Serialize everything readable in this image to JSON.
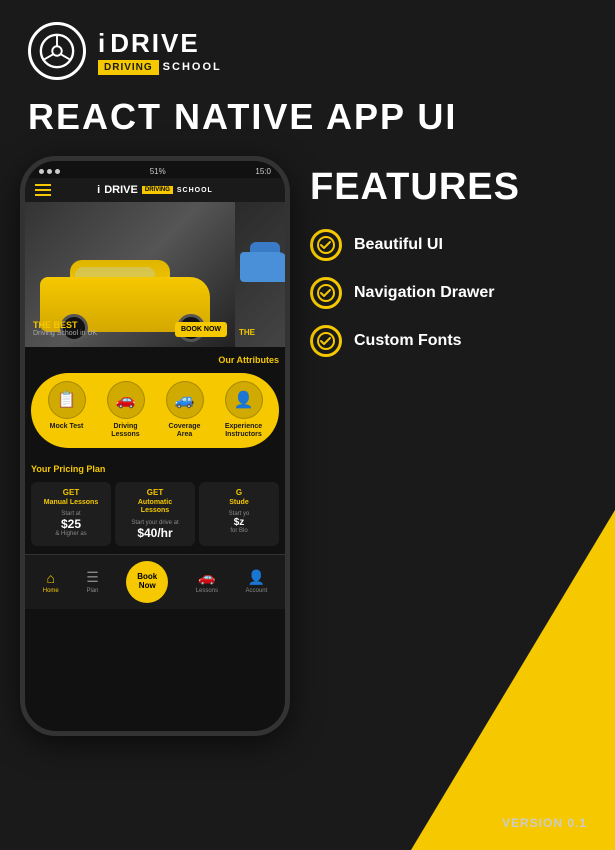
{
  "header": {
    "logo_i": "i",
    "logo_drive": "DRIVE",
    "badge_driving": "DRIVING",
    "badge_school": "SCHOOL"
  },
  "main_title": "REACT NATIVE APP UI",
  "phone": {
    "status_bar": {
      "left": "≡",
      "battery": "51%",
      "time": "15:0"
    },
    "app_header": {
      "logo_i": "i",
      "logo_drive": "DRIVE",
      "badge": "DRIVING",
      "school": "SCHOOL"
    },
    "carousel": {
      "main_label": "THE BEST",
      "main_sublabel": "Driving School in UK",
      "btn_label": "BOOK NOW",
      "side_label": "THE"
    },
    "attributes": {
      "title": "Our Attributes",
      "items": [
        {
          "label": "Mock Test",
          "icon": "📋"
        },
        {
          "label": "Driving\nLessons",
          "icon": "🚗"
        },
        {
          "label": "Coverage\nArea",
          "icon": "🚙"
        },
        {
          "label": "Experience\nInstructors",
          "icon": "👤"
        }
      ]
    },
    "pricing": {
      "title": "Your Pricing Plan",
      "cards": [
        {
          "get": "GET",
          "type": "Manual Lessons",
          "start_text": "Start at",
          "price": "$25",
          "note": "& Higher as"
        },
        {
          "get": "GET",
          "type": "Automatic\nLessons",
          "start_text": "Start your drive at",
          "price": "$40/hr",
          "note": ""
        },
        {
          "get": "G",
          "type": "Stude",
          "start_text": "Start yo",
          "price": "$z",
          "note": "for Blo"
        }
      ]
    },
    "bottom_nav": {
      "items": [
        {
          "label": "Home",
          "active": true
        },
        {
          "label": "Plan",
          "active": false
        },
        {
          "label": "Book\nNow",
          "is_cta": true
        },
        {
          "label": "Lessons",
          "active": false
        },
        {
          "label": "Account",
          "active": false
        }
      ],
      "book_btn": "Book\nNow"
    }
  },
  "features": {
    "title": "FEATURES",
    "items": [
      {
        "text": "Beautiful UI"
      },
      {
        "text": "Navigation Drawer"
      },
      {
        "text": "Custom Fonts"
      }
    ]
  },
  "version": "VERSION 0.1"
}
